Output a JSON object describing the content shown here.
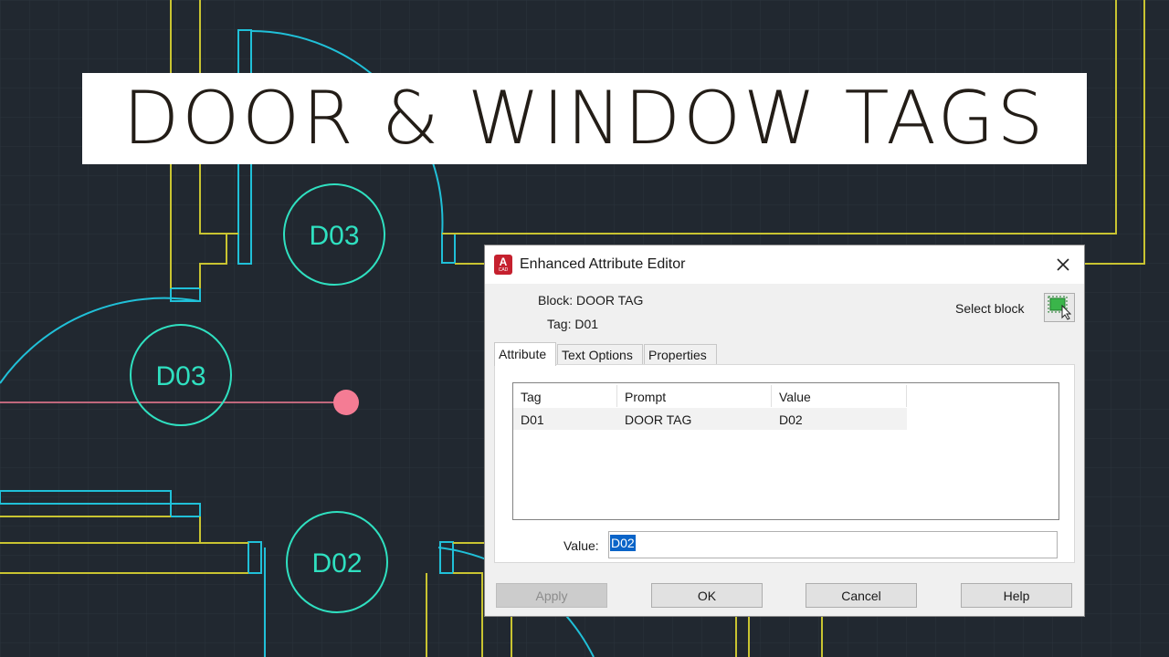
{
  "banner": {
    "title": "DOOR & WINDOW TAGS"
  },
  "drawing": {
    "tags": [
      "D03",
      "D03",
      "D02"
    ],
    "colors": {
      "background": "#212830",
      "walls": "#c9c431",
      "tag_circle": "#2fe0c0",
      "door_swing": "#20c0d8",
      "grip": "#f47c94"
    }
  },
  "dialog": {
    "title": "Enhanced Attribute Editor",
    "app_icon": {
      "letter": "A",
      "caption": "CAD"
    },
    "close_icon": "close-icon",
    "block_label": "Block:",
    "block_value": "DOOR TAG",
    "tag_label": "Tag:",
    "tag_value": "D01",
    "select_block_label": "Select block",
    "tabs": [
      {
        "label": "Attribute",
        "active": true
      },
      {
        "label": "Text Options",
        "active": false
      },
      {
        "label": "Properties",
        "active": false
      }
    ],
    "attribute_list": {
      "columns": [
        "Tag",
        "Prompt",
        "Value"
      ],
      "rows": [
        {
          "tag": "D01",
          "prompt": "DOOR TAG",
          "value": "D02"
        }
      ]
    },
    "value_label": "Value:",
    "value_field": "D02",
    "buttons": {
      "apply": "Apply",
      "ok": "OK",
      "cancel": "Cancel",
      "help": "Help"
    }
  }
}
